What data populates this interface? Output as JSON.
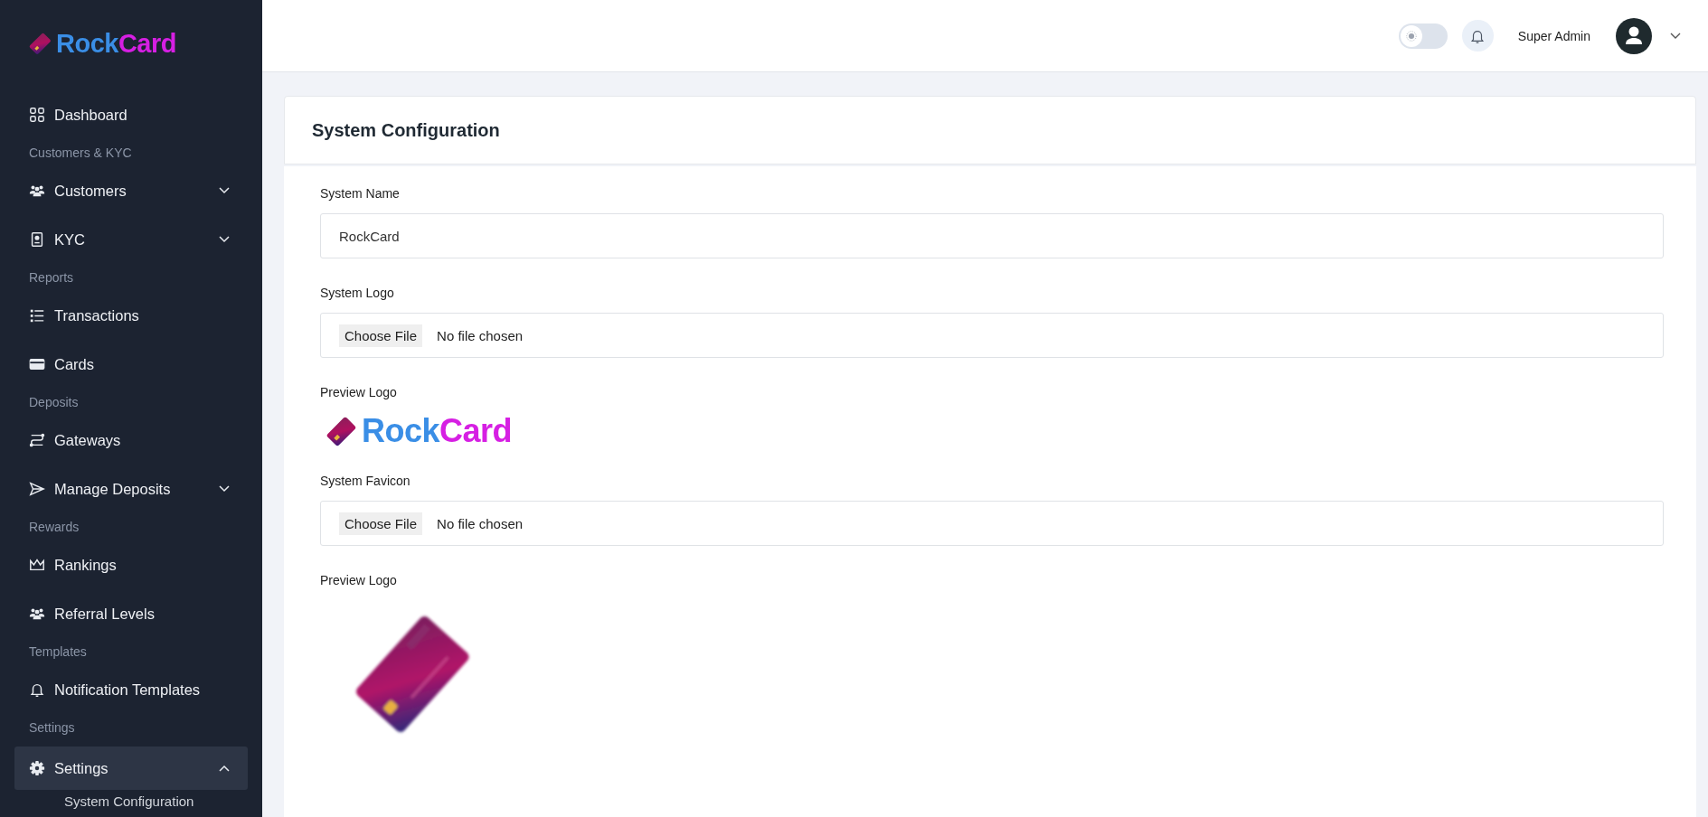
{
  "sidebar": {
    "brand": [
      {
        "text": "Rock",
        "color": "#3a8ee6"
      },
      {
        "text": "Card",
        "color": "#d61fe3"
      }
    ],
    "nav": [
      {
        "kind": "item",
        "label": "Dashboard",
        "selected": false
      },
      {
        "kind": "section",
        "label": "Customers & KYC"
      },
      {
        "kind": "item",
        "label": "Customers",
        "selected": false,
        "expanded": false
      },
      {
        "kind": "item",
        "label": "KYC",
        "selected": false,
        "expanded": false
      },
      {
        "kind": "section",
        "label": "Reports"
      },
      {
        "kind": "item",
        "label": "Transactions",
        "selected": false
      },
      {
        "kind": "item",
        "label": "Cards",
        "selected": false
      },
      {
        "kind": "section",
        "label": "Deposits"
      },
      {
        "kind": "item",
        "label": "Gateways",
        "selected": false
      },
      {
        "kind": "item",
        "label": "Manage Deposits",
        "selected": false,
        "expanded": false
      },
      {
        "kind": "section",
        "label": "Rewards"
      },
      {
        "kind": "item",
        "label": "Rankings",
        "selected": false
      },
      {
        "kind": "item",
        "label": "Referral Levels",
        "selected": false
      },
      {
        "kind": "section",
        "label": "Templates"
      },
      {
        "kind": "item",
        "label": "Notification Templates",
        "selected": false
      },
      {
        "kind": "section",
        "label": "Settings"
      },
      {
        "kind": "item",
        "label": "Settings",
        "selected": true,
        "expanded": true,
        "children": [
          {
            "label": "System Configuration"
          }
        ]
      }
    ]
  },
  "header": {
    "theme_toggle": {
      "on": false
    },
    "user": {
      "name": "Super Admin"
    }
  },
  "page": {
    "title": "System Configuration",
    "fields": [
      {
        "kind": "text",
        "label": "System Name",
        "value": "RockCard"
      },
      {
        "kind": "file",
        "label": "System Logo",
        "button": "Choose File",
        "status": "No file chosen"
      },
      {
        "kind": "logo",
        "label": "Preview Logo",
        "brand": [
          {
            "text": "Rock",
            "color": "#3a8ee6"
          },
          {
            "text": "Card",
            "color": "#d61fe3"
          }
        ]
      },
      {
        "kind": "file",
        "label": "System Favicon",
        "button": "Choose File",
        "status": "No file chosen"
      },
      {
        "kind": "favicon",
        "label": "Preview Logo"
      }
    ]
  }
}
